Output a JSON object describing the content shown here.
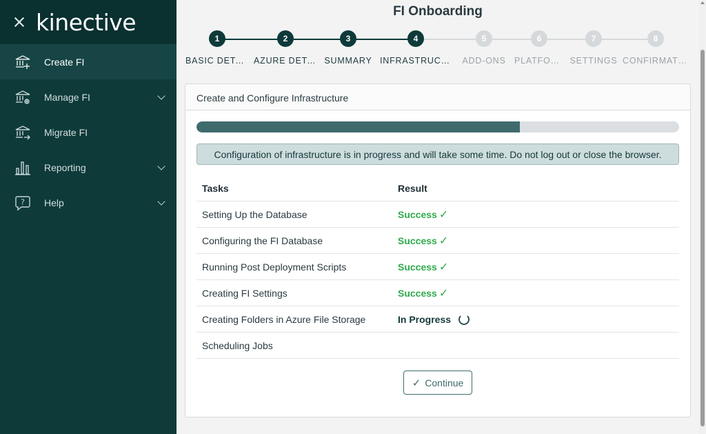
{
  "app": {
    "logo_text": "kinective",
    "brand_color": "#0e3a3a"
  },
  "sidebar": {
    "items": [
      {
        "label": "Create FI",
        "icon": "bank-add-icon",
        "active": true,
        "expandable": false
      },
      {
        "label": "Manage FI",
        "icon": "bank-gear-icon",
        "active": false,
        "expandable": true
      },
      {
        "label": "Migrate FI",
        "icon": "bank-migrate-icon",
        "active": false,
        "expandable": false
      },
      {
        "label": "Reporting",
        "icon": "bar-chart-icon",
        "active": false,
        "expandable": true
      },
      {
        "label": "Help",
        "icon": "help-bubble-icon",
        "active": false,
        "expandable": true
      }
    ]
  },
  "page": {
    "title": "FI Onboarding"
  },
  "stepper": {
    "steps": [
      {
        "number": "1",
        "label": "BASIC DETAILS",
        "state": "done"
      },
      {
        "number": "2",
        "label": "AZURE DETAILS",
        "state": "done"
      },
      {
        "number": "3",
        "label": "SUMMARY",
        "state": "done"
      },
      {
        "number": "4",
        "label": "INFRASTRUCTURE",
        "state": "current"
      },
      {
        "number": "5",
        "label": "ADD-ONS",
        "state": "todo"
      },
      {
        "number": "6",
        "label": "PLATFORM",
        "state": "todo"
      },
      {
        "number": "7",
        "label": "SETTINGS",
        "state": "todo"
      },
      {
        "number": "8",
        "label": "CONFIRMATION",
        "state": "todo"
      }
    ]
  },
  "card": {
    "title": "Create and Configure Infrastructure",
    "progress_percent": 67,
    "alert": "Configuration of infrastructure is in progress and will take some time. Do not log out or close the browser.",
    "table": {
      "headers": {
        "task": "Tasks",
        "result": "Result"
      },
      "rows": [
        {
          "task": "Setting Up the Database",
          "result": "Success",
          "status": "success"
        },
        {
          "task": "Configuring the FI Database",
          "result": "Success",
          "status": "success"
        },
        {
          "task": "Running Post Deployment Scripts",
          "result": "Success",
          "status": "success"
        },
        {
          "task": "Creating FI Settings",
          "result": "Success",
          "status": "success"
        },
        {
          "task": "Creating Folders in Azure File Storage",
          "result": "In Progress",
          "status": "progress"
        },
        {
          "task": "Scheduling Jobs",
          "result": "",
          "status": "pending"
        }
      ]
    },
    "continue_label": "Continue"
  }
}
